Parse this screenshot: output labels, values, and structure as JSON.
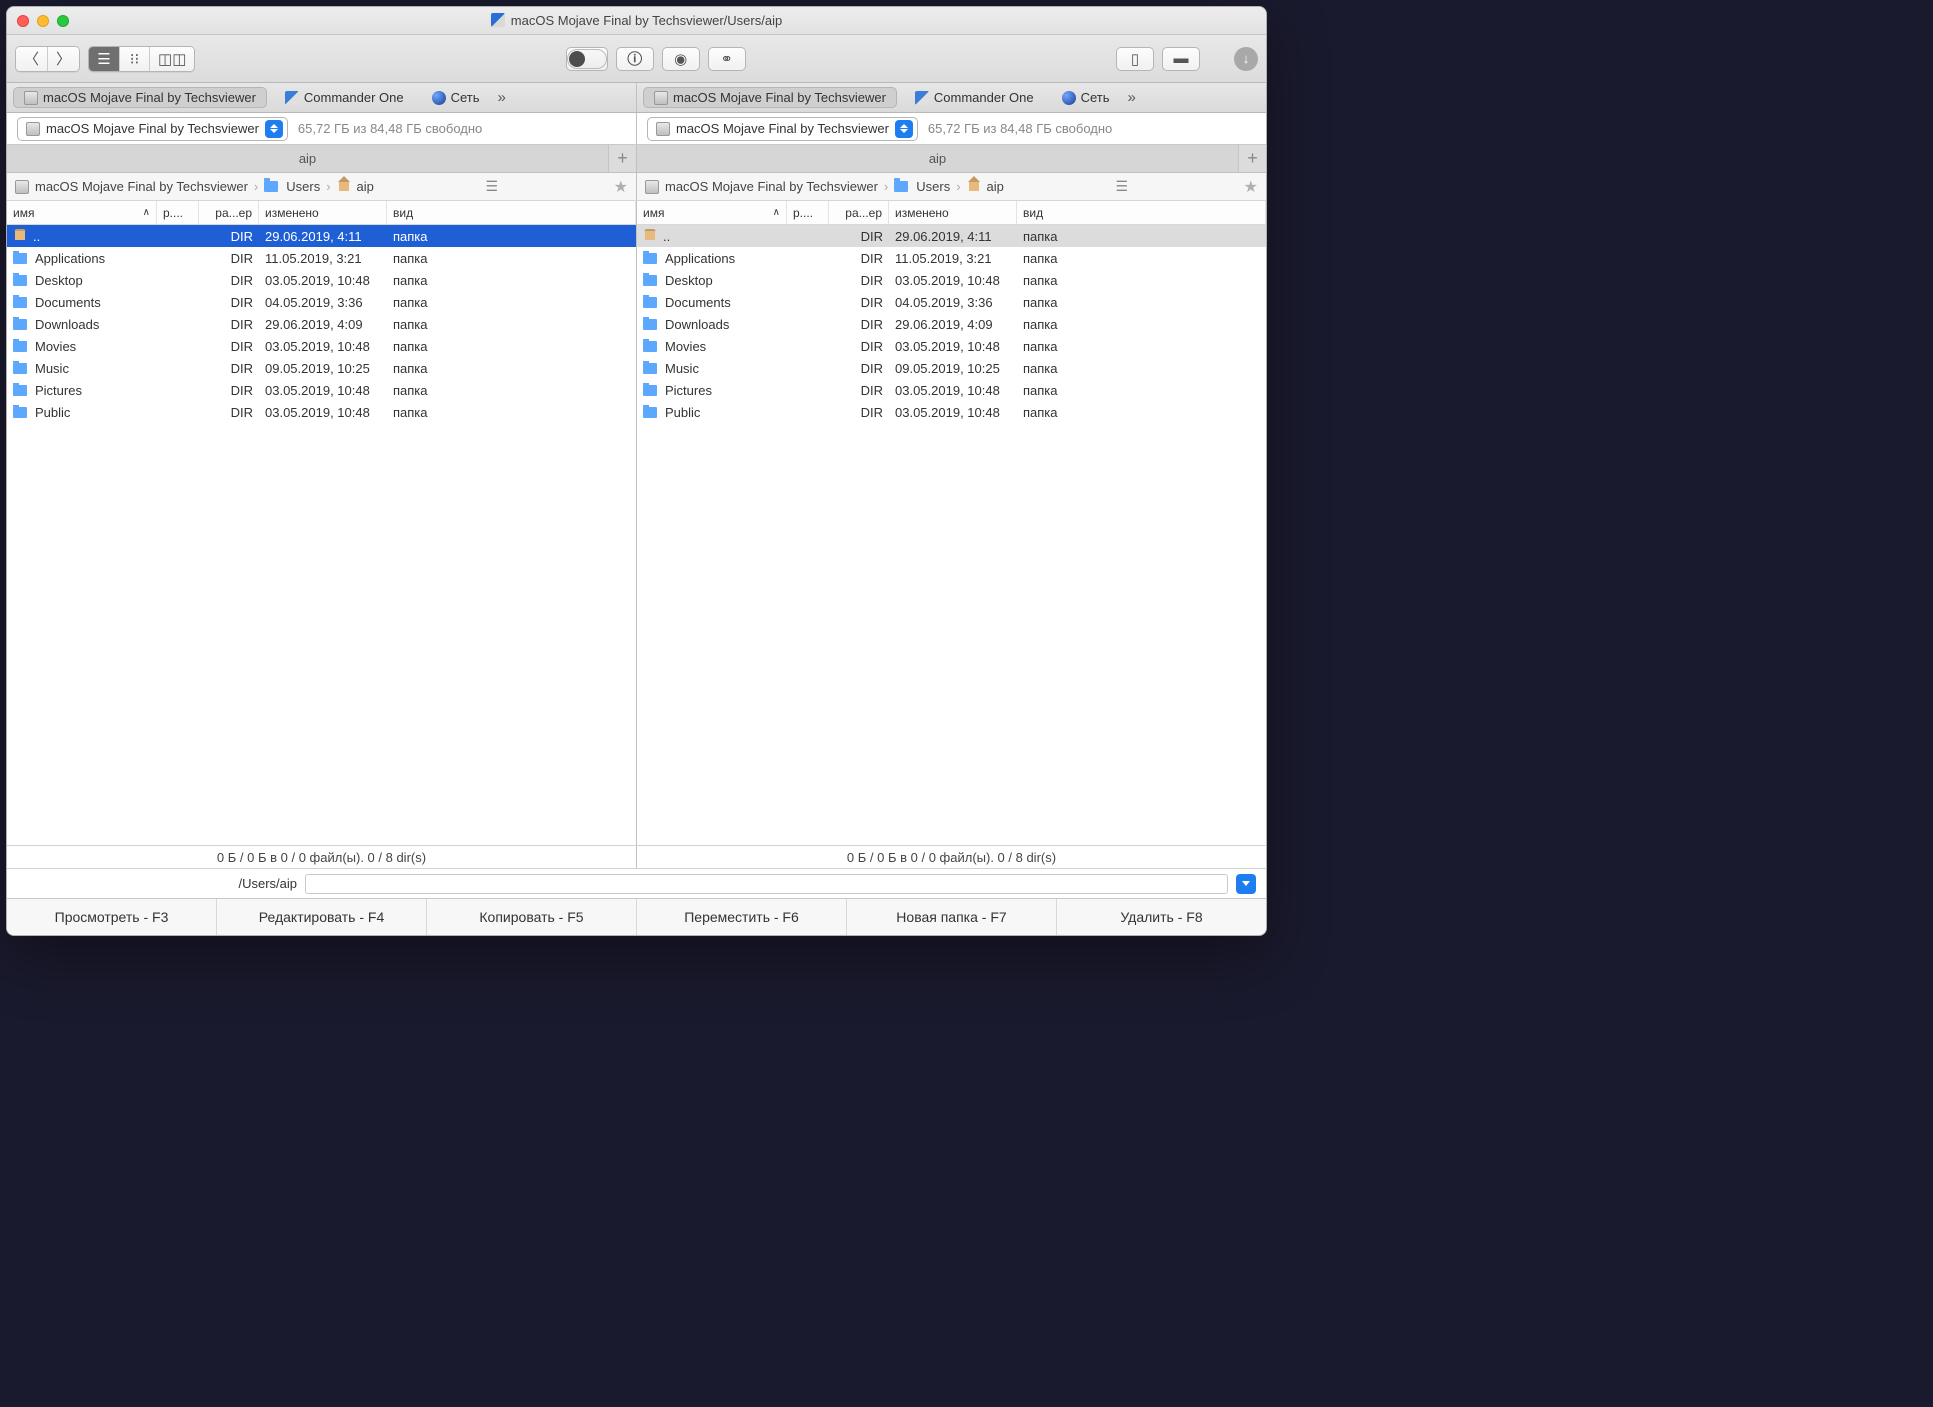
{
  "title": "macOS Mojave Final by Techsviewer/Users/aip",
  "volTabs": [
    {
      "label": "macOS Mojave Final by Techsviewer",
      "icon": "disk",
      "sel": true
    },
    {
      "label": "Commander One",
      "icon": "app"
    },
    {
      "label": "Сеть",
      "icon": "globe"
    }
  ],
  "volSelect": "macOS Mojave Final by Techsviewer",
  "freeSpace": "65,72 ГБ из 84,48 ГБ свободно",
  "pathTab": "aip",
  "crumbs": [
    {
      "label": "macOS Mojave Final by Techsviewer",
      "icon": "disk"
    },
    {
      "label": "Users",
      "icon": "folder"
    },
    {
      "label": "aip",
      "icon": "home"
    }
  ],
  "columns": {
    "name": "имя",
    "ext": "р....",
    "size": "ра...ер",
    "date": "изменено",
    "kind": "вид"
  },
  "rows": [
    {
      "icon": "home",
      "name": "..",
      "size": "DIR",
      "date": "29.06.2019, 4:11",
      "kind": "папка"
    },
    {
      "icon": "folder",
      "name": "Applications",
      "size": "DIR",
      "date": "11.05.2019, 3:21",
      "kind": "папка"
    },
    {
      "icon": "folder",
      "name": "Desktop",
      "size": "DIR",
      "date": "03.05.2019, 10:48",
      "kind": "папка"
    },
    {
      "icon": "folder",
      "name": "Documents",
      "size": "DIR",
      "date": "04.05.2019, 3:36",
      "kind": "папка"
    },
    {
      "icon": "folder",
      "name": "Downloads",
      "size": "DIR",
      "date": "29.06.2019, 4:09",
      "kind": "папка"
    },
    {
      "icon": "folder",
      "name": "Movies",
      "size": "DIR",
      "date": "03.05.2019, 10:48",
      "kind": "папка"
    },
    {
      "icon": "folder",
      "name": "Music",
      "size": "DIR",
      "date": "09.05.2019, 10:25",
      "kind": "папка"
    },
    {
      "icon": "folder",
      "name": "Pictures",
      "size": "DIR",
      "date": "03.05.2019, 10:48",
      "kind": "папка"
    },
    {
      "icon": "folder",
      "name": "Public",
      "size": "DIR",
      "date": "03.05.2019, 10:48",
      "kind": "папка"
    }
  ],
  "statusText": "0 Б / 0 Б в 0 / 0 файл(ы). 0 / 8 dir(s)",
  "cmdPath": "/Users/aip",
  "fkeys": [
    "Просмотреть - F3",
    "Редактировать - F4",
    "Копировать - F5",
    "Переместить - F6",
    "Новая папка - F7",
    "Удалить - F8"
  ]
}
